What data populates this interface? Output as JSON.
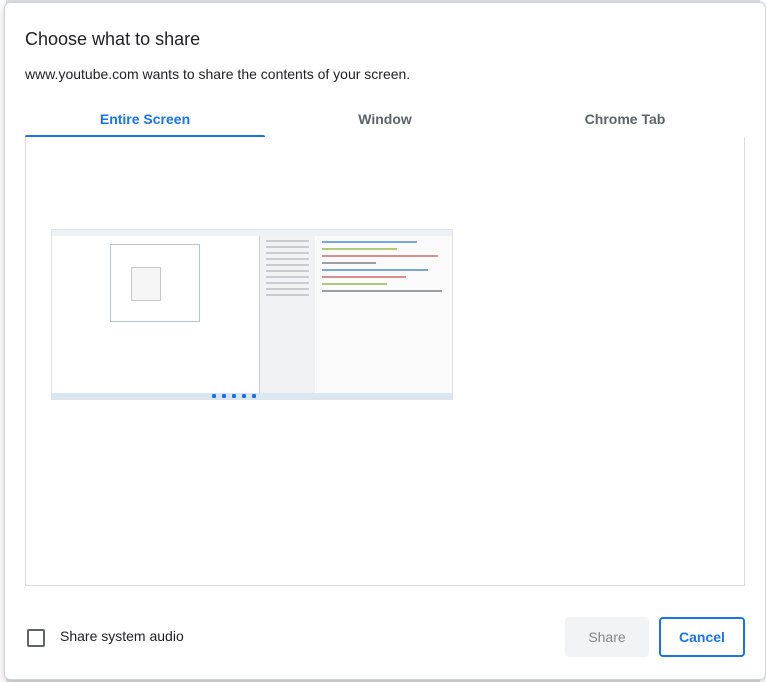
{
  "dialog": {
    "title": "Choose what to share",
    "subtitle": "www.youtube.com wants to share the contents of your screen."
  },
  "tabs": [
    {
      "label": "Entire Screen",
      "active": true
    },
    {
      "label": "Window",
      "active": false
    },
    {
      "label": "Chrome Tab",
      "active": false
    }
  ],
  "footer": {
    "audio_label": "Share system audio",
    "audio_checked": false,
    "share_label": "Share",
    "cancel_label": "Cancel"
  },
  "colors": {
    "accent": "#1a73e8",
    "text": "#202124",
    "muted": "#5f6368"
  }
}
